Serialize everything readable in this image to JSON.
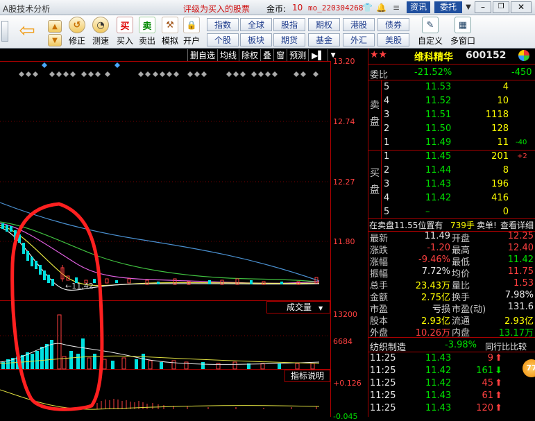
{
  "window": {
    "app_name": "A股技术分析",
    "notice": "评级为买入的股票",
    "coins_label": "金币:",
    "coins_value": "10",
    "user": "mo_220304268",
    "btn_info": "资讯",
    "btn_order": "委托"
  },
  "toolbar": {
    "buttons": [
      {
        "id": "up",
        "label": "",
        "icon": "▲"
      },
      {
        "id": "down",
        "label": "",
        "icon": "▼"
      },
      {
        "id": "fix",
        "label": "修正",
        "icon": "↺"
      },
      {
        "id": "speed",
        "label": "测速",
        "icon": "◔"
      },
      {
        "id": "buy",
        "label": "买入",
        "icon": "买"
      },
      {
        "id": "sell",
        "label": "卖出",
        "icon": "卖"
      },
      {
        "id": "sim",
        "label": "模拟",
        "icon": "⚒"
      },
      {
        "id": "open",
        "label": "开户",
        "icon": "🔒"
      }
    ],
    "markets_row1": [
      "指数",
      "全球",
      "股指",
      "期权",
      "港股",
      "债券"
    ],
    "markets_row2": [
      "个股",
      "板块",
      "期货",
      "基金",
      "外汇",
      "美股"
    ],
    "custom": "自定义",
    "multi": "多窗口"
  },
  "chart": {
    "menu": [
      "删自选",
      "均线",
      "除权",
      "叠",
      "窗",
      "预测"
    ],
    "price_ticks": [
      "13.20",
      "12.74",
      "12.27",
      "11.80"
    ],
    "low_label": "←11.42",
    "vol_label": "成交量",
    "vol_ticks": [
      "13200",
      "6684"
    ],
    "ind_label": "指标说明",
    "ind_ticks": [
      "+0.126",
      "-0.045"
    ]
  },
  "stock": {
    "name": "维科精华",
    "code": "600152"
  },
  "orderbook": {
    "weibi_label": "委比",
    "weibi_pct": "-21.52%",
    "weibi_diff": "-450",
    "sell_label": "卖盘",
    "buy_label": "买盘",
    "sell": [
      {
        "lvl": "5",
        "price": "11.53",
        "vol": "4",
        "chg": ""
      },
      {
        "lvl": "4",
        "price": "11.52",
        "vol": "10",
        "chg": ""
      },
      {
        "lvl": "3",
        "price": "11.51",
        "vol": "1118",
        "chg": ""
      },
      {
        "lvl": "2",
        "price": "11.50",
        "vol": "128",
        "chg": ""
      },
      {
        "lvl": "1",
        "price": "11.49",
        "vol": "11",
        "chg": "-40"
      }
    ],
    "buy": [
      {
        "lvl": "1",
        "price": "11.45",
        "vol": "201",
        "chg": "+2"
      },
      {
        "lvl": "2",
        "price": "11.44",
        "vol": "8",
        "chg": ""
      },
      {
        "lvl": "3",
        "price": "11.43",
        "vol": "196",
        "chg": ""
      },
      {
        "lvl": "4",
        "price": "11.42",
        "vol": "416",
        "chg": ""
      },
      {
        "lvl": "5",
        "price": "–",
        "vol": "0",
        "chg": ""
      }
    ]
  },
  "notice_bar": {
    "text": "在卖盘11.55位置有",
    "vol": "739手",
    "action": "卖单!",
    "detail": "查看详细"
  },
  "quote": [
    {
      "l1": "最新",
      "v1": "11.49",
      "l2": "开盘",
      "v2": "12.25"
    },
    {
      "l1": "涨跌",
      "v1": "-1.20",
      "l2": "最高",
      "v2": "12.40"
    },
    {
      "l1": "涨幅",
      "v1": "-9.46%",
      "l2": "最低",
      "v2": "11.42"
    },
    {
      "l1": "振幅",
      "v1": "7.72%",
      "l2": "均价",
      "v2": "11.75"
    },
    {
      "l1": "总手",
      "v1": "23.43万",
      "l2": "量比",
      "v2": "1.53"
    },
    {
      "l1": "金额",
      "v1": "2.75亿",
      "l2": "换手",
      "v2": "7.98%"
    },
    {
      "l1": "市盈",
      "v1": "亏损",
      "l2": "市盈(动)",
      "v2": "131.6"
    },
    {
      "l1": "股本",
      "v1": "2.93亿",
      "l2": "流通",
      "v2": "2.93亿"
    },
    {
      "l1": "外盘",
      "v1": "10.26万",
      "l2": "内盘",
      "v2": "13.17万"
    }
  ],
  "industry": {
    "name": "纺织制造",
    "pct": "-3.98%",
    "compare": "同行比比较"
  },
  "ticks": [
    {
      "time": "11:25",
      "price": "11.43",
      "vol": "9",
      "dir": "up"
    },
    {
      "time": "11:25",
      "price": "11.42",
      "vol": "161",
      "dir": "down"
    },
    {
      "time": "11:25",
      "price": "11.42",
      "vol": "45",
      "dir": "up"
    },
    {
      "time": "11:25",
      "price": "11.43",
      "vol": "61",
      "dir": "up"
    },
    {
      "time": "11:25",
      "price": "11.43",
      "vol": "120",
      "dir": "up"
    }
  ],
  "badge": "77"
}
